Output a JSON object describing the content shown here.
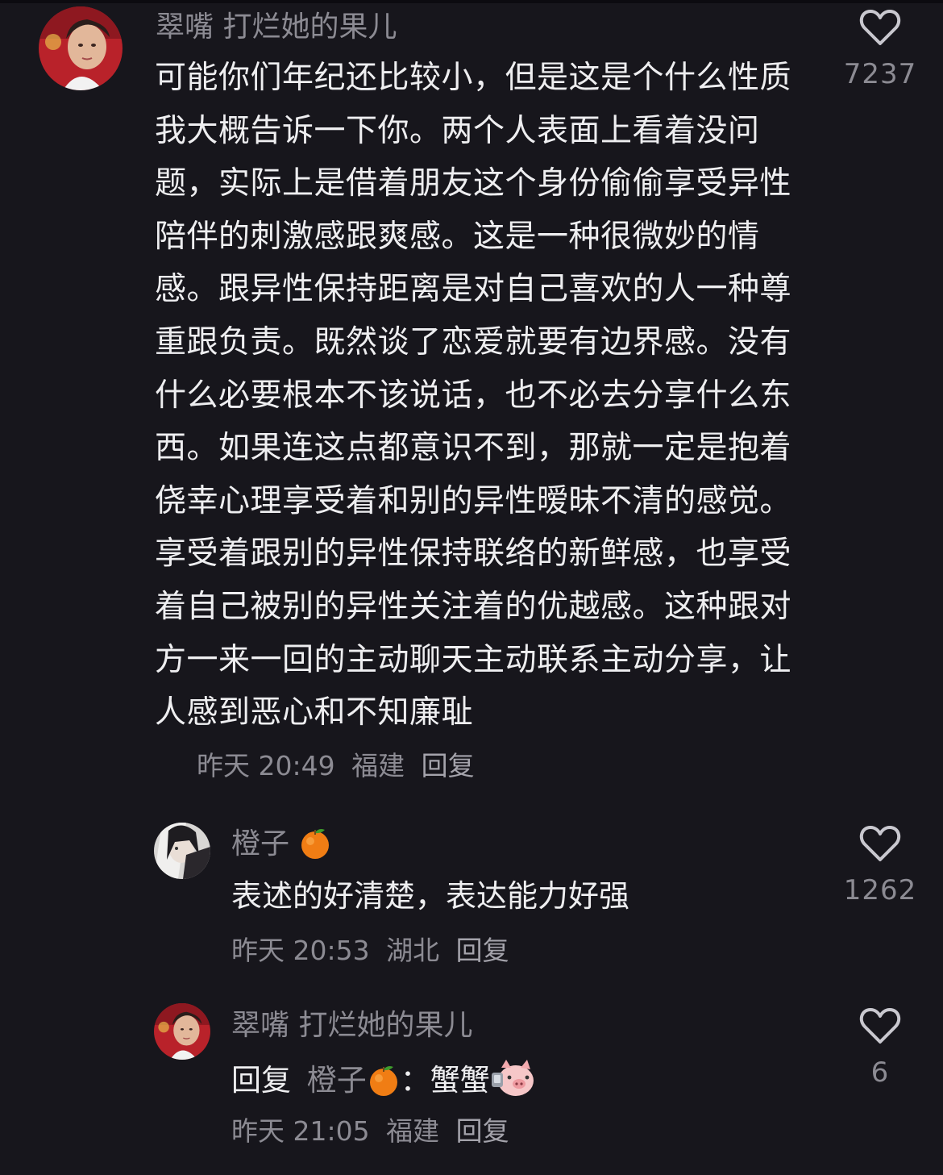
{
  "comments": [
    {
      "username": "翠嘴 打烂她的果儿",
      "text": "可能你们年纪还比较小，但是这是个什么性质我大概告诉一下你。两个人表面上看着没问题，实际上是借着朋友这个身份偷偷享受异性陪伴的刺激感跟爽感。这是一种很微妙的情感。跟异性保持距离是对自己喜欢的人一种尊重跟负责。既然谈了恋爱就要有边界感。没有什么必要根本不该说话，也不必去分享什么东西。如果连这点都意识不到，那就一定是抱着侥幸心理享受着和别的异性暧昧不清的感觉。享受着跟别的异性保持联络的新鲜感，也享受着自己被别的异性关注着的优越感。这种跟对方一来一回的主动聊天主动联系主动分享，让人感到恶心和不知廉耻",
      "time": "昨天 20:49",
      "location": "福建",
      "reply_label": "回复",
      "likes": "7237",
      "avatar_icon": "avatar-woman-red-background"
    },
    {
      "username": "橙子",
      "username_emoji": "orange-emoji-icon",
      "text": "表述的好清楚，表达能力好强",
      "time": "昨天 20:53",
      "location": "湖北",
      "reply_label": "回复",
      "likes": "1262",
      "avatar_icon": "avatar-anime-character"
    },
    {
      "username": "翠嘴 打烂她的果儿",
      "reply_prefix": "回复",
      "reply_target": "橙子",
      "reply_target_emoji": "orange-emoji-icon",
      "reply_separator": "：",
      "text": "蟹蟹",
      "text_emoji": "pig-face-emoji-icon",
      "time": "昨天 21:05",
      "location": "福建",
      "reply_label": "回复",
      "likes": "6",
      "avatar_icon": "avatar-woman-red-background"
    }
  ],
  "colors": {
    "background": "#17161c",
    "primary_text": "#eeeef0",
    "secondary_text": "#8c8b93"
  },
  "icons": {
    "like": "heart-outline-icon"
  }
}
